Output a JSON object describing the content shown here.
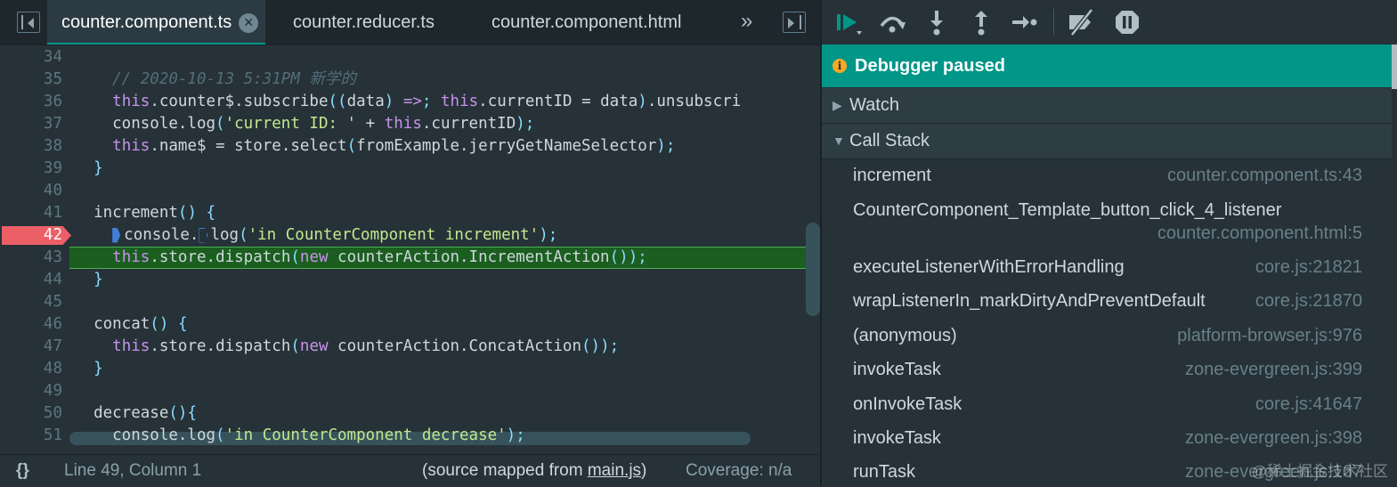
{
  "tabs": [
    {
      "label": "counter.component.ts",
      "active": true
    },
    {
      "label": "counter.reducer.ts",
      "active": false
    },
    {
      "label": "counter.component.html",
      "active": false
    }
  ],
  "tab_more": "»",
  "code": {
    "breakpoint_line": "42",
    "exec_line": "43",
    "lines": [
      {
        "n": "34",
        "t": ""
      },
      {
        "n": "35",
        "t": "    // 2020-10-13 5:31PM 新学的"
      },
      {
        "n": "36",
        "t": "    this.counter$.subscribe((data) => this.currentID = data).unsubscri"
      },
      {
        "n": "37",
        "t": "    console.log('current ID: ' + this.currentID);"
      },
      {
        "n": "38",
        "t": "    this.name$ = store.select(fromExample.jerryGetNameSelector);"
      },
      {
        "n": "39",
        "t": "  }"
      },
      {
        "n": "40",
        "t": ""
      },
      {
        "n": "41",
        "t": "  increment() {"
      },
      {
        "n": "42",
        "t": "    console.log('in CounterComponent increment');"
      },
      {
        "n": "43",
        "t": "    this.store.dispatch(new counterAction.IncrementAction());"
      },
      {
        "n": "44",
        "t": "  }"
      },
      {
        "n": "45",
        "t": ""
      },
      {
        "n": "46",
        "t": "  concat() {"
      },
      {
        "n": "47",
        "t": "    this.store.dispatch(new counterAction.ConcatAction());"
      },
      {
        "n": "48",
        "t": "  }"
      },
      {
        "n": "49",
        "t": ""
      },
      {
        "n": "50",
        "t": "  decrease(){"
      },
      {
        "n": "51",
        "t": "    console.log('in CounterComponent decrease');"
      }
    ]
  },
  "status": {
    "braces": "{}",
    "position": "Line 49, Column 1",
    "source_prefix": "(source mapped from ",
    "source_link": "main.js",
    "source_suffix": ")",
    "coverage": "Coverage: n/a"
  },
  "debugger": {
    "paused_label": "Debugger paused",
    "info_glyph": "i",
    "watch_label": "Watch",
    "call_stack_label": "Call Stack",
    "frames": [
      {
        "fn": "increment",
        "loc": "counter.component.ts:43"
      },
      {
        "fn": "CounterComponent_Template_button_click_4_listener",
        "loc": "counter.component.html:5"
      },
      {
        "fn": "executeListenerWithErrorHandling",
        "loc": "core.js:21821"
      },
      {
        "fn": "wrapListenerIn_markDirtyAndPreventDefault",
        "loc": "core.js:21870"
      },
      {
        "fn": "(anonymous)",
        "loc": "platform-browser.js:976"
      },
      {
        "fn": "invokeTask",
        "loc": "zone-evergreen.js:399"
      },
      {
        "fn": "onInvokeTask",
        "loc": "core.js:41647"
      },
      {
        "fn": "invokeTask",
        "loc": "zone-evergreen.js:398"
      },
      {
        "fn": "runTask",
        "loc": "zone-evergreen.js:167"
      }
    ]
  },
  "watermark": "@稀土掘金技术社区",
  "colors": {
    "accent": "#009688",
    "breakpoint": "#ec5f67",
    "exec_line": "#1b5e20"
  }
}
